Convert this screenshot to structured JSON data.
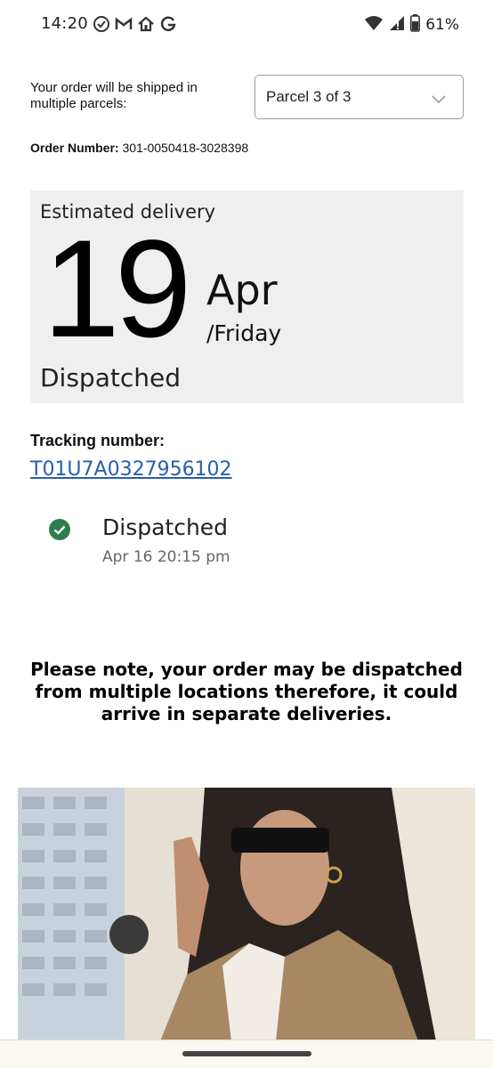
{
  "status_bar": {
    "time": "14:20",
    "battery": "61%",
    "icons_left": [
      "check-circle-icon",
      "gmail-icon",
      "home-icon",
      "google-icon"
    ],
    "icons_right": [
      "wifi-icon",
      "signal-icon",
      "battery-icon"
    ]
  },
  "shipping": {
    "note": "Your order will be shipped in multiple parcels:",
    "parcel_selected": "Parcel 3 of 3"
  },
  "order": {
    "label": "Order Number:",
    "number": "301-0050418-3028398"
  },
  "delivery": {
    "label": "Estimated delivery",
    "day": "19",
    "month": "Apr",
    "weekday": "/Friday",
    "status": "Dispatched"
  },
  "tracking": {
    "label": "Tracking number:",
    "number": "T01U7A0327956102"
  },
  "events": [
    {
      "title": "Dispatched",
      "time": "Apr 16 20:15 pm",
      "icon": "check-circle-icon"
    }
  ],
  "notice": "Please note, your order may be dispatched from multiple locations therefore, it could arrive in separate deliveries.",
  "colors": {
    "link": "#2a5db0",
    "success": "#2e7d4f",
    "card_bg": "#efefef"
  }
}
